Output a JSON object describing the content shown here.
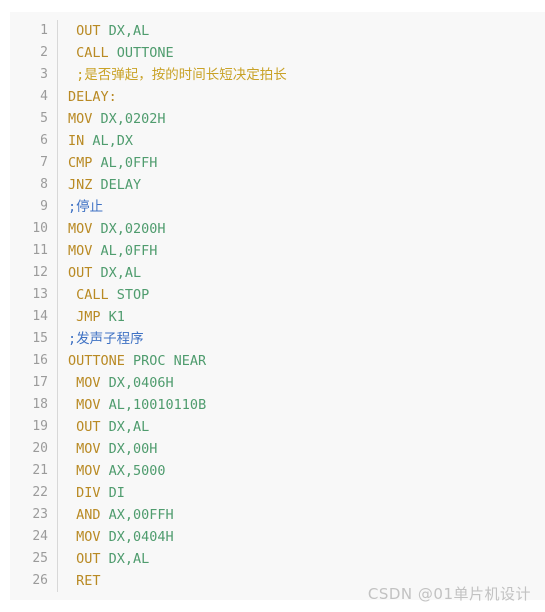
{
  "editor": {
    "language": "assembly",
    "background_color": "#f8f8f8",
    "gutter_color": "#9b9b9b",
    "keyword_color": "#b98a24",
    "operand_color": "#4f9c6e",
    "comment_blue_color": "#3f72c4",
    "comment_gold_color": "#c9a227",
    "lines": [
      {
        "number": "1",
        "indent": " ",
        "segments": [
          {
            "text": "OUT",
            "type": "kw"
          },
          {
            "text": " DX,AL",
            "type": "op"
          }
        ]
      },
      {
        "number": "2",
        "indent": " ",
        "segments": [
          {
            "text": "CALL",
            "type": "kw"
          },
          {
            "text": " OUTTONE",
            "type": "op"
          }
        ]
      },
      {
        "number": "3",
        "indent": " ",
        "segments": [
          {
            "text": ";是否弹起，按的时间长短决定拍长",
            "type": "comment-gold"
          }
        ]
      },
      {
        "number": "4",
        "indent": "",
        "segments": [
          {
            "text": "DELAY:",
            "type": "kw"
          }
        ]
      },
      {
        "number": "5",
        "indent": "",
        "segments": [
          {
            "text": "MOV",
            "type": "kw"
          },
          {
            "text": " DX,0202H",
            "type": "op"
          }
        ]
      },
      {
        "number": "6",
        "indent": "",
        "segments": [
          {
            "text": "IN",
            "type": "kw"
          },
          {
            "text": " AL,DX",
            "type": "op"
          }
        ]
      },
      {
        "number": "7",
        "indent": "",
        "segments": [
          {
            "text": "CMP",
            "type": "kw"
          },
          {
            "text": " AL,0FFH",
            "type": "op"
          }
        ]
      },
      {
        "number": "8",
        "indent": "",
        "segments": [
          {
            "text": "JNZ",
            "type": "kw"
          },
          {
            "text": " DELAY",
            "type": "op"
          }
        ]
      },
      {
        "number": "9",
        "indent": "",
        "segments": [
          {
            "text": ";停止",
            "type": "comment-blue"
          }
        ]
      },
      {
        "number": "10",
        "indent": "",
        "segments": [
          {
            "text": "MOV",
            "type": "kw"
          },
          {
            "text": " DX,0200H",
            "type": "op"
          }
        ]
      },
      {
        "number": "11",
        "indent": "",
        "segments": [
          {
            "text": "MOV",
            "type": "kw"
          },
          {
            "text": " AL,0FFH",
            "type": "op"
          }
        ]
      },
      {
        "number": "12",
        "indent": "",
        "segments": [
          {
            "text": "OUT",
            "type": "kw"
          },
          {
            "text": " DX,AL",
            "type": "op"
          }
        ]
      },
      {
        "number": "13",
        "indent": " ",
        "segments": [
          {
            "text": "CALL",
            "type": "kw"
          },
          {
            "text": " STOP",
            "type": "op"
          }
        ]
      },
      {
        "number": "14",
        "indent": " ",
        "segments": [
          {
            "text": "JMP",
            "type": "kw"
          },
          {
            "text": " K1",
            "type": "op"
          }
        ]
      },
      {
        "number": "15",
        "indent": "",
        "segments": [
          {
            "text": ";发声子程序",
            "type": "comment-blue"
          }
        ]
      },
      {
        "number": "16",
        "indent": "",
        "segments": [
          {
            "text": "OUTTONE",
            "type": "kw"
          },
          {
            "text": " PROC NEAR",
            "type": "op"
          }
        ]
      },
      {
        "number": "17",
        "indent": " ",
        "segments": [
          {
            "text": "MOV",
            "type": "kw"
          },
          {
            "text": " DX,0406H",
            "type": "op"
          }
        ]
      },
      {
        "number": "18",
        "indent": " ",
        "segments": [
          {
            "text": "MOV",
            "type": "kw"
          },
          {
            "text": " AL,10010110B",
            "type": "op"
          }
        ]
      },
      {
        "number": "19",
        "indent": " ",
        "segments": [
          {
            "text": "OUT",
            "type": "kw"
          },
          {
            "text": " DX,AL",
            "type": "op"
          }
        ]
      },
      {
        "number": "20",
        "indent": " ",
        "segments": [
          {
            "text": "MOV",
            "type": "kw"
          },
          {
            "text": " DX,00H",
            "type": "op"
          }
        ]
      },
      {
        "number": "21",
        "indent": " ",
        "segments": [
          {
            "text": "MOV",
            "type": "kw"
          },
          {
            "text": " AX,5000",
            "type": "op"
          }
        ]
      },
      {
        "number": "22",
        "indent": " ",
        "segments": [
          {
            "text": "DIV",
            "type": "kw"
          },
          {
            "text": " DI",
            "type": "op"
          }
        ]
      },
      {
        "number": "23",
        "indent": " ",
        "segments": [
          {
            "text": "AND",
            "type": "kw"
          },
          {
            "text": " AX,00FFH",
            "type": "op"
          }
        ]
      },
      {
        "number": "24",
        "indent": " ",
        "segments": [
          {
            "text": "MOV",
            "type": "kw"
          },
          {
            "text": " DX,0404H",
            "type": "op"
          }
        ]
      },
      {
        "number": "25",
        "indent": " ",
        "segments": [
          {
            "text": "OUT",
            "type": "kw"
          },
          {
            "text": " DX,AL",
            "type": "op"
          }
        ]
      },
      {
        "number": "26",
        "indent": " ",
        "segments": [
          {
            "text": "RET",
            "type": "kw"
          }
        ]
      }
    ]
  },
  "watermark": {
    "text": "CSDN @01单片机设计"
  }
}
